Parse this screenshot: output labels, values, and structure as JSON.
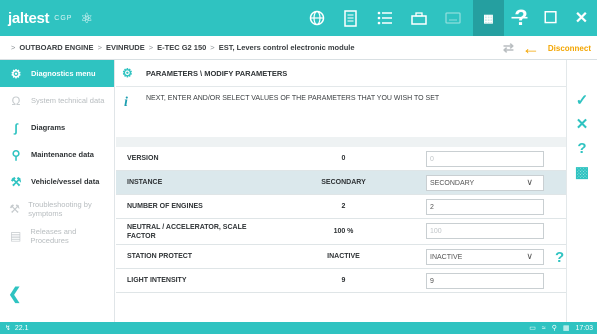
{
  "brand": {
    "name": "jaltest",
    "product": "CGP"
  },
  "crumbs": [
    "OUTBOARD ENGINE",
    "EVINRUDE",
    "E-TEC G2 150",
    "EST, Levers control electronic module"
  ],
  "disconnect_label": "Disconnect",
  "sidebar": {
    "items": [
      {
        "label": "Diagnostics menu"
      },
      {
        "label": "System technical data"
      },
      {
        "label": "Diagrams"
      },
      {
        "label": "Maintenance data"
      },
      {
        "label": "Vehicle/vessel data"
      },
      {
        "label": "Troubleshooting by symptoms"
      },
      {
        "label": "Releases and Procedures"
      }
    ]
  },
  "main": {
    "title": "PARAMETERS \\ MODIFY PARAMETERS",
    "info": "NEXT, ENTER AND/OR SELECT VALUES OF THE PARAMETERS THAT YOU WISH TO SET"
  },
  "params": [
    {
      "name": "VERSION",
      "current": "0",
      "input": "0"
    },
    {
      "name": "INSTANCE",
      "current": "SECONDARY",
      "input": "SECONDARY"
    },
    {
      "name": "NUMBER OF ENGINES",
      "current": "2",
      "input": "2"
    },
    {
      "name": "NEUTRAL / ACCELERATOR, SCALE FACTOR",
      "current": "100 %",
      "input": "100"
    },
    {
      "name": "STATION PROTECT",
      "current": "INACTIVE",
      "input": "INACTIVE"
    },
    {
      "name": "LIGHT INTENSITY",
      "current": "9",
      "input": "9"
    }
  ],
  "status": {
    "left": "22.1",
    "time": "17:03"
  },
  "colors": {
    "accent": "#2fc3c1",
    "warning": "#f3a500"
  }
}
